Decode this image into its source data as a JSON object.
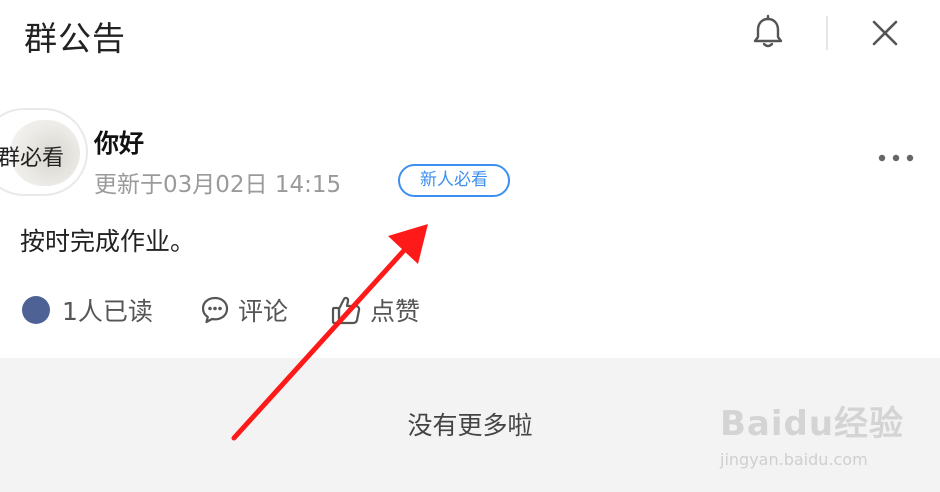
{
  "header": {
    "title": "群公告",
    "bell_icon": "bell-icon",
    "close_icon": "close-icon"
  },
  "post": {
    "avatar_text": "群必看",
    "title": "你好",
    "meta": "更新于03月02日 14:15",
    "tag": "新人必看",
    "content": "按时完成作业。",
    "more_icon": "more-icon"
  },
  "actions": {
    "read_label": "1人已读",
    "comment_label": "评论",
    "like_label": "点赞"
  },
  "footer": {
    "text": "没有更多啦"
  },
  "watermark": {
    "brand": "Baidu经验",
    "url": "jingyan.baidu.com"
  },
  "colors": {
    "accent": "#3d8ff0",
    "read_dot": "#4f6296",
    "annotation_arrow": "#ff1a1a",
    "footer_bg": "#f3f3f3"
  }
}
